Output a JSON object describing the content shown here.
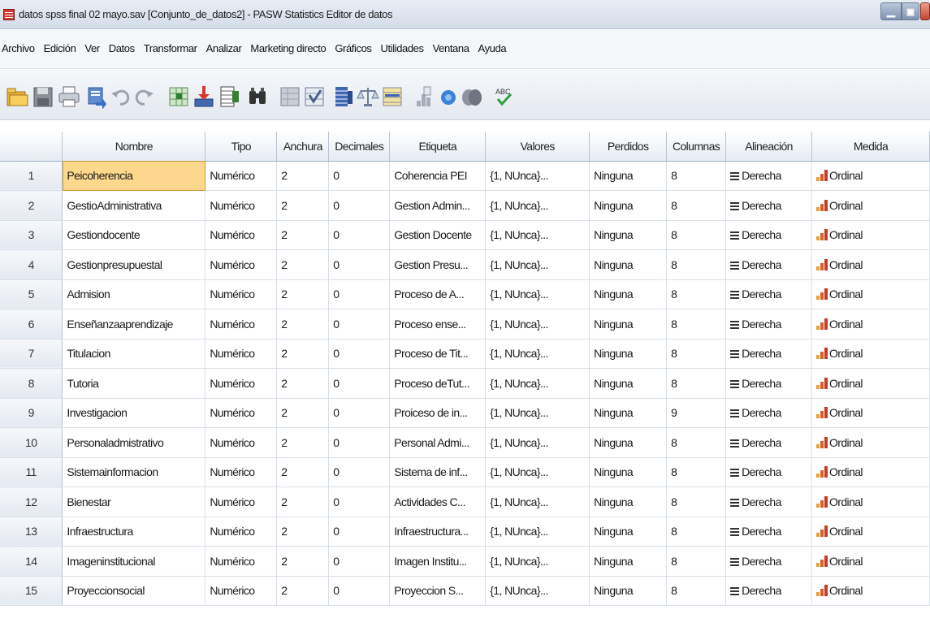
{
  "window": {
    "title": "datos spss final 02 mayo.sav [Conjunto_de_datos2] - PASW Statistics Editor de datos"
  },
  "menu": [
    "Archivo",
    "Edición",
    "Ver",
    "Datos",
    "Transformar",
    "Analizar",
    "Marketing directo",
    "Gráficos",
    "Utilidades",
    "Ventana",
    "Ayuda"
  ],
  "toolbar_icons": [
    "open-icon",
    "save-icon",
    "print-icon",
    "dialog-recall-icon",
    "undo-icon",
    "redo-icon",
    "goto-case-icon",
    "goto-variable-icon",
    "variables-icon",
    "find-icon",
    "insert-cases-icon",
    "insert-variable-icon",
    "split-file-icon",
    "weight-cases-icon",
    "select-cases-icon",
    "value-labels-icon",
    "use-sets-icon",
    "show-all-variables-icon",
    "spell-check-icon"
  ],
  "grid": {
    "headers": [
      "Nombre",
      "Tipo",
      "Anchura",
      "Decimales",
      "Etiqueta",
      "Valores",
      "Perdidos",
      "Columnas",
      "Alineación",
      "Medida"
    ],
    "rows": [
      {
        "num": "1",
        "nombre": "Peicoherencia",
        "tipo": "Numérico",
        "anchura": "2",
        "decimales": "0",
        "etiqueta": "Coherencia PEI",
        "valores": "{1, NUnca}...",
        "perdidos": "Ninguna",
        "columnas": "8",
        "alineacion": "Derecha",
        "medida": "Ordinal"
      },
      {
        "num": "2",
        "nombre": "GestioAdministrativa",
        "tipo": "Numérico",
        "anchura": "2",
        "decimales": "0",
        "etiqueta": "Gestion Admin...",
        "valores": "{1, NUnca}...",
        "perdidos": "Ninguna",
        "columnas": "8",
        "alineacion": "Derecha",
        "medida": "Ordinal"
      },
      {
        "num": "3",
        "nombre": "Gestiondocente",
        "tipo": "Numérico",
        "anchura": "2",
        "decimales": "0",
        "etiqueta": "Gestion Docente",
        "valores": "{1, NUnca}...",
        "perdidos": "Ninguna",
        "columnas": "8",
        "alineacion": "Derecha",
        "medida": "Ordinal"
      },
      {
        "num": "4",
        "nombre": "Gestionpresupuestal",
        "tipo": "Numérico",
        "anchura": "2",
        "decimales": "0",
        "etiqueta": "Gestion Presu...",
        "valores": "{1, NUnca}...",
        "perdidos": "Ninguna",
        "columnas": "8",
        "alineacion": "Derecha",
        "medida": "Ordinal"
      },
      {
        "num": "5",
        "nombre": "Admision",
        "tipo": "Numérico",
        "anchura": "2",
        "decimales": "0",
        "etiqueta": "Proceso de A...",
        "valores": "{1, NUnca}...",
        "perdidos": "Ninguna",
        "columnas": "8",
        "alineacion": "Derecha",
        "medida": "Ordinal"
      },
      {
        "num": "6",
        "nombre": "Enseñanzaaprendizaje",
        "tipo": "Numérico",
        "anchura": "2",
        "decimales": "0",
        "etiqueta": "Proceso ense...",
        "valores": "{1, NUnca}...",
        "perdidos": "Ninguna",
        "columnas": "8",
        "alineacion": "Derecha",
        "medida": "Ordinal"
      },
      {
        "num": "7",
        "nombre": "Titulacion",
        "tipo": "Numérico",
        "anchura": "2",
        "decimales": "0",
        "etiqueta": "Proceso de Tit...",
        "valores": "{1, NUnca}...",
        "perdidos": "Ninguna",
        "columnas": "8",
        "alineacion": "Derecha",
        "medida": "Ordinal"
      },
      {
        "num": "8",
        "nombre": "Tutoria",
        "tipo": "Numérico",
        "anchura": "2",
        "decimales": "0",
        "etiqueta": "Proceso deTut...",
        "valores": "{1, NUnca}...",
        "perdidos": "Ninguna",
        "columnas": "8",
        "alineacion": "Derecha",
        "medida": "Ordinal"
      },
      {
        "num": "9",
        "nombre": "Investigacion",
        "tipo": "Numérico",
        "anchura": "2",
        "decimales": "0",
        "etiqueta": "Proiceso de in...",
        "valores": "{1, NUnca}...",
        "perdidos": "Ninguna",
        "columnas": "9",
        "alineacion": "Derecha",
        "medida": "Ordinal"
      },
      {
        "num": "10",
        "nombre": "Personaladmistrativo",
        "tipo": "Numérico",
        "anchura": "2",
        "decimales": "0",
        "etiqueta": "Personal Admi...",
        "valores": "{1, NUnca}...",
        "perdidos": "Ninguna",
        "columnas": "8",
        "alineacion": "Derecha",
        "medida": "Ordinal"
      },
      {
        "num": "11",
        "nombre": "Sistemainformacion",
        "tipo": "Numérico",
        "anchura": "2",
        "decimales": "0",
        "etiqueta": "Sistema de inf...",
        "valores": "{1, NUnca}...",
        "perdidos": "Ninguna",
        "columnas": "8",
        "alineacion": "Derecha",
        "medida": "Ordinal"
      },
      {
        "num": "12",
        "nombre": "Bienestar",
        "tipo": "Numérico",
        "anchura": "2",
        "decimales": "0",
        "etiqueta": "Actividades C...",
        "valores": "{1, NUnca}...",
        "perdidos": "Ninguna",
        "columnas": "8",
        "alineacion": "Derecha",
        "medida": "Ordinal"
      },
      {
        "num": "13",
        "nombre": "Infraestructura",
        "tipo": "Numérico",
        "anchura": "2",
        "decimales": "0",
        "etiqueta": "Infraestructura...",
        "valores": "{1, NUnca}...",
        "perdidos": "Ninguna",
        "columnas": "8",
        "alineacion": "Derecha",
        "medida": "Ordinal"
      },
      {
        "num": "14",
        "nombre": "Imageninstitucional",
        "tipo": "Numérico",
        "anchura": "2",
        "decimales": "0",
        "etiqueta": "Imagen Institu...",
        "valores": "{1, NUnca}...",
        "perdidos": "Ninguna",
        "columnas": "8",
        "alineacion": "Derecha",
        "medida": "Ordinal"
      },
      {
        "num": "15",
        "nombre": "Proyeccionsocial",
        "tipo": "Numérico",
        "anchura": "2",
        "decimales": "0",
        "etiqueta": "Proyeccion S...",
        "valores": "{1, NUnca}...",
        "perdidos": "Ninguna",
        "columnas": "8",
        "alineacion": "Derecha",
        "medida": "Ordinal"
      }
    ],
    "active_row": 0
  }
}
